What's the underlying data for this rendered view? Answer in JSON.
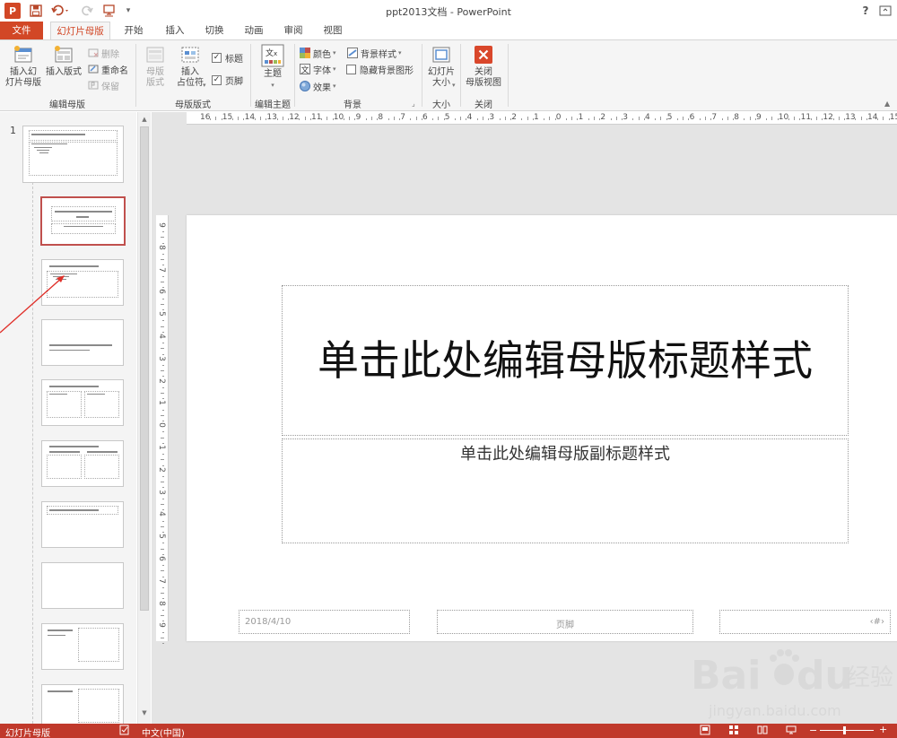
{
  "window": {
    "title": "ppt2013文档 - PowerPoint",
    "help": "?",
    "app_icon": "P"
  },
  "tabs": [
    {
      "label": "文件"
    },
    {
      "label": "幻灯片母版"
    },
    {
      "label": "开始"
    },
    {
      "label": "插入"
    },
    {
      "label": "切换"
    },
    {
      "label": "动画"
    },
    {
      "label": "审阅"
    },
    {
      "label": "视图"
    }
  ],
  "ribbon": {
    "insert_slide_master": "插入幻\n灯片母版",
    "insert_layout": "插入版式",
    "delete": "删除",
    "rename": "重命名",
    "preserve": "保留",
    "group_edit_master": "编辑母版",
    "master_layout": "母版\n版式",
    "insert_placeholder": "插入\n占位符",
    "title_check": "标题",
    "footer_check": "页脚",
    "group_master_layout": "母版版式",
    "themes": "主题",
    "group_edit_theme": "编辑主题",
    "colors": "颜色",
    "fonts": "字体",
    "effects": "效果",
    "background_styles": "背景样式",
    "hide_background": "隐藏背景图形",
    "group_background": "背景",
    "slide_size": "幻灯片\n大小",
    "group_size": "大小",
    "close_master_view": "关闭\n母版视图",
    "group_close": "关闭"
  },
  "thumbs": {
    "first_number": "1"
  },
  "ruler": {
    "h_labels": [
      "16",
      "15",
      "14",
      "13",
      "12",
      "11",
      "10",
      "9",
      "8",
      "7",
      "6",
      "5",
      "4",
      "3",
      "2",
      "1",
      "0",
      "1",
      "2",
      "3",
      "4",
      "5",
      "6",
      "7",
      "8",
      "9",
      "10",
      "11",
      "12",
      "13",
      "14",
      "15"
    ],
    "v_labels": [
      "9",
      "8",
      "7",
      "6",
      "5",
      "4",
      "3",
      "2",
      "1",
      "0",
      "1",
      "2",
      "3",
      "4",
      "5",
      "6",
      "7",
      "8",
      "9"
    ]
  },
  "slide": {
    "title": "单击此处编辑母版标题样式",
    "subtitle": "单击此处编辑母版副标题样式",
    "footer_date": "2018/4/10",
    "footer_text": "页脚",
    "footer_number": "‹#›"
  },
  "status": {
    "mode": "幻灯片母版",
    "language": "中文(中国)"
  },
  "watermark": {
    "brand": "Bai",
    "brand2": "du",
    "cn": "经验",
    "url": "jingyan.baidu.com"
  },
  "colors": {
    "accent": "#d24726",
    "status_bar": "#c0392b",
    "ribbon_bg": "#f5f5f5"
  }
}
